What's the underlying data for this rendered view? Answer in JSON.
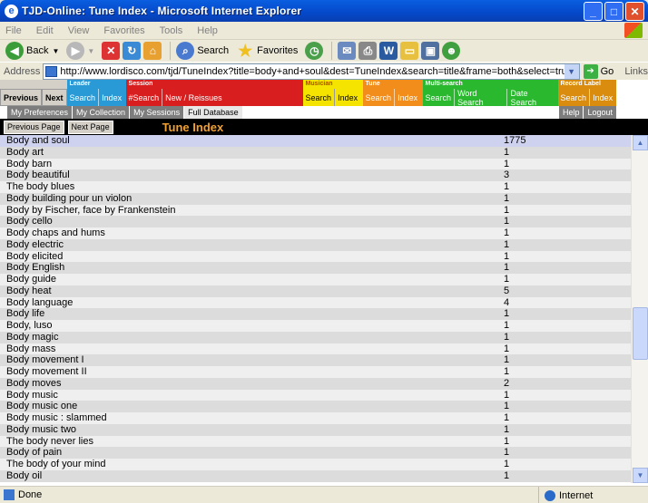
{
  "window": {
    "title": "TJD-Online: Tune Index - Microsoft Internet Explorer"
  },
  "menu": [
    "File",
    "Edit",
    "View",
    "Favorites",
    "Tools",
    "Help"
  ],
  "toolbar": {
    "back": "Back",
    "search": "Search",
    "favorites": "Favorites"
  },
  "address": {
    "label": "Address",
    "url": "http://www.lordisco.com/tjd/TuneIndex?title=body+and+soul&dest=TuneIndex&search=title&frame=both&select=true",
    "go": "Go",
    "links": "Links"
  },
  "nav": {
    "previous": "Previous",
    "next": "Next",
    "leader": {
      "label": "Leader",
      "search": "Search",
      "index": "Index"
    },
    "session": {
      "label": "Session",
      "search": "#Search",
      "new": "New / Reissues"
    },
    "musician": {
      "label": "Musician",
      "search": "Search",
      "index": "Index"
    },
    "tune": {
      "label": "Tune",
      "search": "Search",
      "index": "Index"
    },
    "multisearch": {
      "label": "Multi-search",
      "search": "Search",
      "word": "Word Search",
      "date": "Date Search"
    },
    "record_label": {
      "label": "Record Label",
      "search": "Search",
      "index": "Index"
    }
  },
  "tabs": {
    "preferences": "My Preferences",
    "collection": "My Collection",
    "sessions": "My Sessions",
    "database": "Full Database",
    "help": "Help",
    "logout": "Logout"
  },
  "pager": {
    "prev": "Previous Page",
    "next": "Next Page",
    "title": "Tune Index"
  },
  "colors": {
    "leader": "#2a9ad6",
    "session": "#d81e1e",
    "musician": "#f5e400",
    "tune": "#f28c1a",
    "multisearch": "#29b82e",
    "record_label": "#d98c0e"
  },
  "tunes": [
    {
      "name": "Body and soul",
      "count": "1775"
    },
    {
      "name": "Body art",
      "count": "1"
    },
    {
      "name": "Body barn",
      "count": "1"
    },
    {
      "name": "Body beautiful",
      "count": "3"
    },
    {
      "name": "The body blues",
      "count": "1"
    },
    {
      "name": "Body building pour un violon",
      "count": "1"
    },
    {
      "name": "Body by Fischer, face by Frankenstein",
      "count": "1"
    },
    {
      "name": "Body cello",
      "count": "1"
    },
    {
      "name": "Body chaps and hums",
      "count": "1"
    },
    {
      "name": "Body electric",
      "count": "1"
    },
    {
      "name": "Body elicited",
      "count": "1"
    },
    {
      "name": "Body English",
      "count": "1"
    },
    {
      "name": "Body guide",
      "count": "1"
    },
    {
      "name": "Body heat",
      "count": "5"
    },
    {
      "name": "Body language",
      "count": "4"
    },
    {
      "name": "Body life",
      "count": "1"
    },
    {
      "name": "Body, luso",
      "count": "1"
    },
    {
      "name": "Body magic",
      "count": "1"
    },
    {
      "name": "Body mass",
      "count": "1"
    },
    {
      "name": "Body movement I",
      "count": "1"
    },
    {
      "name": "Body movement II",
      "count": "1"
    },
    {
      "name": "Body moves",
      "count": "2"
    },
    {
      "name": "Body music",
      "count": "1"
    },
    {
      "name": "Body music one",
      "count": "1"
    },
    {
      "name": "Body music : slammed",
      "count": "1"
    },
    {
      "name": "Body music two",
      "count": "1"
    },
    {
      "name": "The body never lies",
      "count": "1"
    },
    {
      "name": "Body of pain",
      "count": "1"
    },
    {
      "name": "The body of your mind",
      "count": "1"
    },
    {
      "name": "Body oil",
      "count": "1"
    }
  ],
  "status": {
    "text": "Done",
    "zone": "Internet"
  }
}
